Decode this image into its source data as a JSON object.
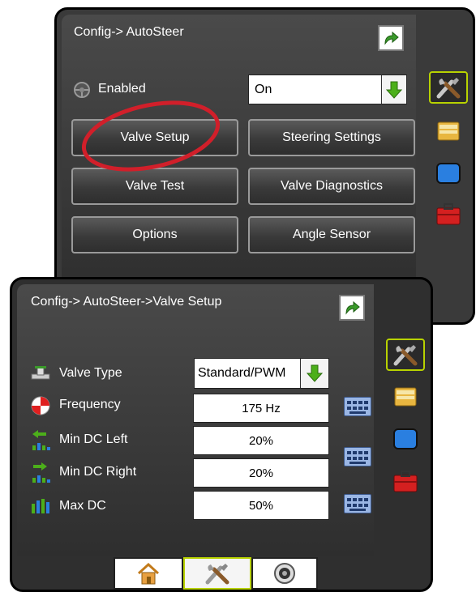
{
  "top_screen": {
    "breadcrumb": "Config-> AutoSteer",
    "enabled_label": "Enabled",
    "enabled_value": "On",
    "buttons": {
      "valve_setup": "Valve Setup",
      "steering_settings": "Steering Settings",
      "valve_test": "Valve Test",
      "valve_diagnostics": "Valve Diagnostics",
      "options": "Options",
      "angle_sensor": "Angle Sensor"
    },
    "highlight_color": "#d11f2a"
  },
  "bottom_screen": {
    "breadcrumb": "Config-> AutoSteer->Valve Setup",
    "rows": [
      {
        "label": "Valve Type",
        "value": "Standard/PWM",
        "icon": "valve-icon"
      },
      {
        "label": "Frequency",
        "value": "175 Hz",
        "icon": "frequency-icon"
      },
      {
        "label": "Min DC Left",
        "value": "20%",
        "icon": "min-dc-left-icon"
      },
      {
        "label": "Min DC Right",
        "value": "20%",
        "icon": "min-dc-right-icon"
      },
      {
        "label": "Max DC",
        "value": "50%",
        "icon": "max-dc-icon"
      }
    ]
  },
  "side_tabs": [
    "tools-icon",
    "folder-icon",
    "blue-display-icon",
    "red-toolbox-icon"
  ],
  "bottom_tabs": [
    "home-icon",
    "tools-icon",
    "gauge-icon"
  ],
  "colors": {
    "accent_green": "#b8d200",
    "arrow_green": "#4caf1a"
  }
}
